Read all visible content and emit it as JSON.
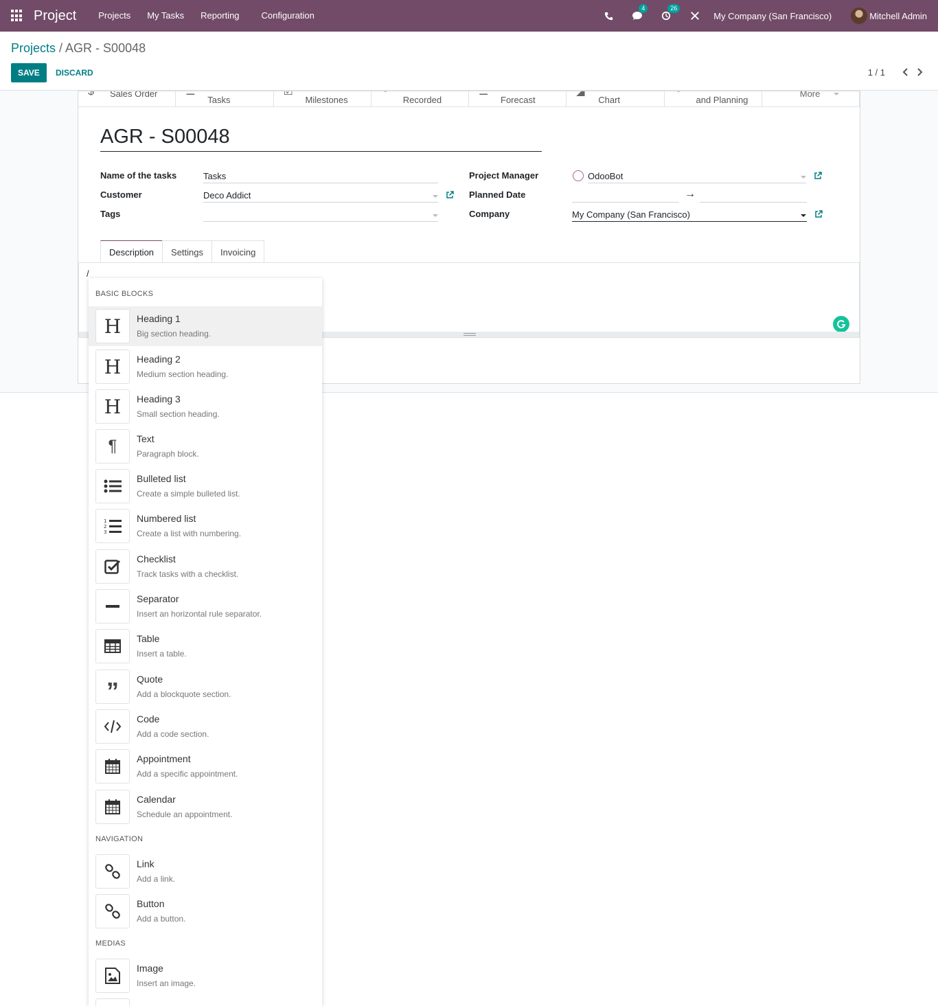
{
  "navbar": {
    "brand": "Project",
    "menu": [
      "Projects",
      "My Tasks",
      "Reporting",
      "Configuration"
    ],
    "messages_count": "4",
    "activities_count": "26",
    "company": "My Company (San Francisco)",
    "user": "Mitchell Admin",
    "accent_color": "#714B67"
  },
  "breadcrumb": {
    "parent": "Projects",
    "separator": " / ",
    "current": "AGR - S00048"
  },
  "actions": {
    "save": "SAVE",
    "discard": "DISCARD"
  },
  "pager": {
    "value": "1 / 1"
  },
  "stat_buttons": [
    "Sales Order",
    "Tasks",
    "Milestones",
    "Recorded",
    "Forecast",
    "Chart",
    "and Planning",
    "More"
  ],
  "form": {
    "title": "AGR - S00048",
    "name_of_tasks_label": "Name of the tasks",
    "name_of_tasks_value": "Tasks",
    "customer_label": "Customer",
    "customer_value": "Deco Addict",
    "tags_label": "Tags",
    "tags_value": "",
    "project_manager_label": "Project Manager",
    "project_manager_value": "OdooBot",
    "planned_date_label": "Planned Date",
    "planned_date_arrow": "→",
    "company_label": "Company",
    "company_value": "My Company (San Francisco)"
  },
  "tabs": [
    "Description",
    "Settings",
    "Invoicing"
  ],
  "editor": {
    "content": "/"
  },
  "powerbox": {
    "sections": [
      "BASIC BLOCKS",
      "NAVIGATION",
      "MEDIAS"
    ],
    "commands": [
      {
        "title": "Heading 1",
        "desc": "Big section heading.",
        "icon": "heading-icon"
      },
      {
        "title": "Heading 2",
        "desc": "Medium section heading.",
        "icon": "heading-icon"
      },
      {
        "title": "Heading 3",
        "desc": "Small section heading.",
        "icon": "heading-icon"
      },
      {
        "title": "Text",
        "desc": "Paragraph block.",
        "icon": "paragraph-icon"
      },
      {
        "title": "Bulleted list",
        "desc": "Create a simple bulleted list.",
        "icon": "bulleted-list-icon"
      },
      {
        "title": "Numbered list",
        "desc": "Create a list with numbering.",
        "icon": "numbered-list-icon"
      },
      {
        "title": "Checklist",
        "desc": "Track tasks with a checklist.",
        "icon": "checklist-icon"
      },
      {
        "title": "Separator",
        "desc": "Insert an horizontal rule separator.",
        "icon": "separator-icon"
      },
      {
        "title": "Table",
        "desc": "Insert a table.",
        "icon": "table-icon"
      },
      {
        "title": "Quote",
        "desc": "Add a blockquote section.",
        "icon": "quote-icon"
      },
      {
        "title": "Code",
        "desc": "Add a code section.",
        "icon": "code-icon"
      },
      {
        "title": "Appointment",
        "desc": "Add a specific appointment.",
        "icon": "calendar-icon"
      },
      {
        "title": "Calendar",
        "desc": "Schedule an appointment.",
        "icon": "calendar-icon"
      },
      {
        "title": "Link",
        "desc": "Add a link.",
        "icon": "link-icon"
      },
      {
        "title": "Button",
        "desc": "Add a button.",
        "icon": "link-icon"
      },
      {
        "title": "Image",
        "desc": "Insert an image.",
        "icon": "image-icon"
      }
    ]
  }
}
